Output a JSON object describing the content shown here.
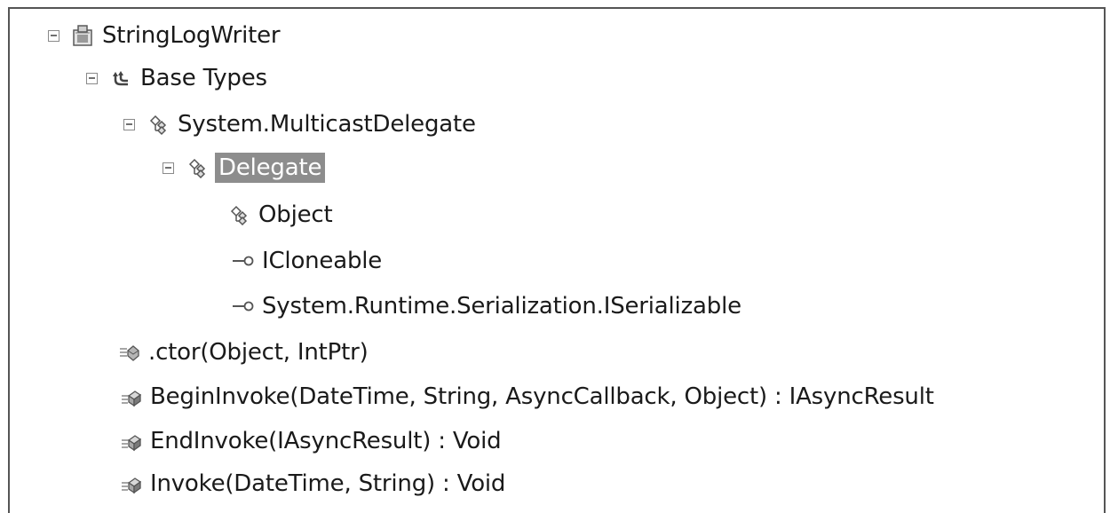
{
  "tree": {
    "root": {
      "label": "StringLogWriter",
      "icon": "delegate-class-icon"
    },
    "base_types": {
      "label": "Base Types",
      "icon": "base-types-icon"
    },
    "multicast": {
      "label": "System.MulticastDelegate",
      "icon": "class-icon"
    },
    "delegate": {
      "label": "Delegate",
      "icon": "class-icon",
      "selected": true
    },
    "object": {
      "label": "Object",
      "icon": "class-icon"
    },
    "icloneable": {
      "label": "ICloneable",
      "icon": "interface-icon"
    },
    "iserializable": {
      "label": "System.Runtime.Serialization.ISerializable",
      "icon": "interface-icon"
    },
    "ctor": {
      "label": ".ctor(Object, IntPtr)",
      "icon": "constructor-icon"
    },
    "begin_invoke": {
      "label": "BeginInvoke(DateTime, String, AsyncCallback, Object) : IAsyncResult",
      "icon": "method-icon"
    },
    "end_invoke": {
      "label": "EndInvoke(IAsyncResult) : Void",
      "icon": "method-icon"
    },
    "invoke": {
      "label": "Invoke(DateTime, String) : Void",
      "icon": "method-icon"
    }
  },
  "colors": {
    "selection": "#8d8d8d",
    "border": "#555555"
  }
}
